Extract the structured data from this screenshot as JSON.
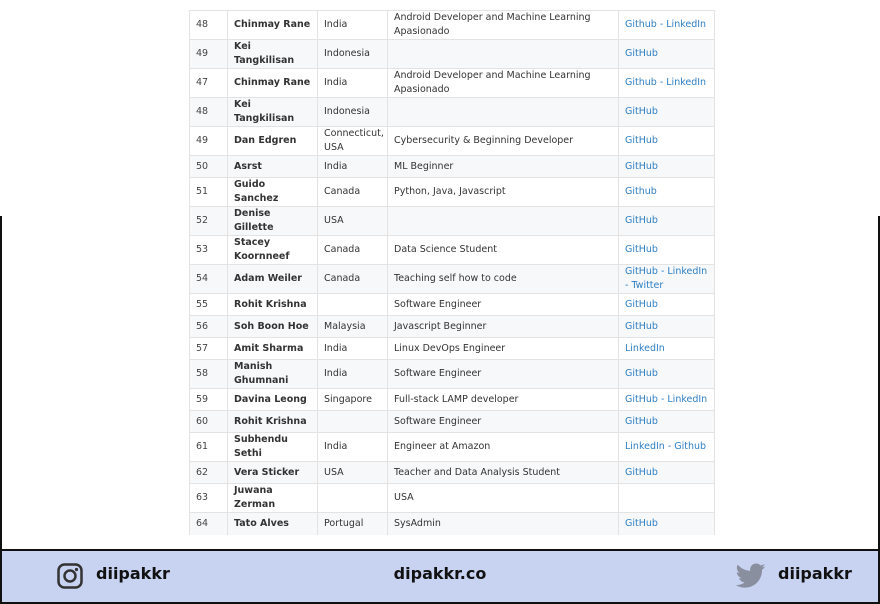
{
  "table": {
    "rows": [
      {
        "num": "48",
        "name": "Chinmay Rane",
        "country": "India",
        "desc": "Android Developer and Machine Learning Apasionado",
        "links": "Github - LinkedIn"
      },
      {
        "num": "49",
        "name": "Kei Tangkilisan",
        "country": "Indonesia",
        "desc": "",
        "links": "GitHub"
      },
      {
        "num": "47",
        "name": "Chinmay Rane",
        "country": "India",
        "desc": "Android Developer and Machine Learning Apasionado",
        "links": "Github - LinkedIn"
      },
      {
        "num": "48",
        "name": "Kei Tangkilisan",
        "country": "Indonesia",
        "desc": "",
        "links": "GitHub"
      },
      {
        "num": "49",
        "name": "Dan Edgren",
        "country": "Connecticut, USA",
        "desc": "Cybersecurity & Beginning Developer",
        "links": "GitHub"
      },
      {
        "num": "50",
        "name": "Asrst",
        "country": "India",
        "desc": "ML Beginner",
        "links": "GitHub"
      },
      {
        "num": "51",
        "name": "Guido Sanchez",
        "country": "Canada",
        "desc": "Python, Java, Javascript",
        "links": "Github"
      },
      {
        "num": "52",
        "name": "Denise Gillette",
        "country": "USA",
        "desc": "",
        "links": "GitHub"
      },
      {
        "num": "53",
        "name": "Stacey Koornneef",
        "country": "Canada",
        "desc": "Data Science Student",
        "links": "GitHub"
      },
      {
        "num": "54",
        "name": "Adam Weiler",
        "country": "Canada",
        "desc": "Teaching self how to code",
        "links": "GitHub - LinkedIn - Twitter"
      },
      {
        "num": "55",
        "name": "Rohit Krishna",
        "country": "",
        "desc": "Software Engineer",
        "links": "GitHub"
      },
      {
        "num": "56",
        "name": "Soh Boon Hoe",
        "country": "Malaysia",
        "desc": "Javascript Beginner",
        "links": "GitHub"
      },
      {
        "num": "57",
        "name": "Amit Sharma",
        "country": "India",
        "desc": "Linux DevOps Engineer",
        "links": "LinkedIn"
      },
      {
        "num": "58",
        "name": "Manish Ghumnani",
        "country": "India",
        "desc": "Software Engineer",
        "links": "GitHub"
      },
      {
        "num": "59",
        "name": "Davina Leong",
        "country": "Singapore",
        "desc": "Full-stack LAMP developer",
        "links": "GitHub - LinkedIn"
      },
      {
        "num": "60",
        "name": "Rohit Krishna",
        "country": "",
        "desc": "Software Engineer",
        "links": "GitHub"
      },
      {
        "num": "61",
        "name": "Subhendu Sethi",
        "country": "India",
        "desc": "Engineer at Amazon",
        "links": "LinkedIn - Github"
      },
      {
        "num": "62",
        "name": "Vera Sticker",
        "country": "USA",
        "desc": "Teacher and Data Analysis Student",
        "links": "GitHub"
      },
      {
        "num": "63",
        "name": "Juwana Zerman",
        "country": "",
        "desc": "USA",
        "links": ""
      },
      {
        "num": "64",
        "name": "Tato Alves",
        "country": "Portugal",
        "desc": "SysAdmin",
        "links": "GitHub"
      }
    ]
  },
  "footer": {
    "instagram_icon": "instagram-icon",
    "instagram_handle": "diipakkr",
    "site": "dipakkr.co",
    "twitter_icon": "twitter-icon",
    "twitter_handle": "diipakkr",
    "background": "#c8d3f2"
  }
}
